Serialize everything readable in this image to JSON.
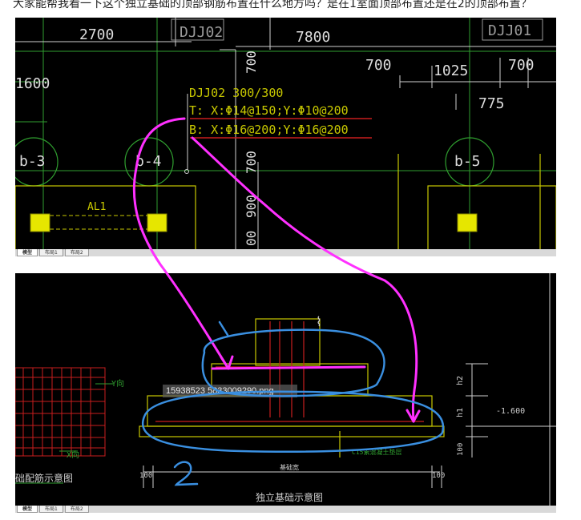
{
  "question": {
    "text": "大家能帮我看一下这个独立基础的顶部钢筋布置在什么地方吗？是在1室面顶部布置还是在2的顶部布置？"
  },
  "top_drawing": {
    "dims": {
      "d2700": "2700",
      "d7800": "7800",
      "d700a": "700",
      "d1025": "1025",
      "d700b": "700",
      "d1600": "1600",
      "d775": "775",
      "d700v": "700",
      "d900v": "900",
      "d00v": "00",
      "d700r": "700"
    },
    "labels": {
      "djj02_top": "DJJ02",
      "djj01_top": "DJJ01",
      "b3": "b-3",
      "b4": "b-4",
      "b5": "b-5",
      "al1": "AL1"
    },
    "annotation": {
      "line1": "DJJ02 300/300",
      "line2": "T: X:Φ14@150;Y:Φ10@200",
      "line3": "B: X:Φ16@200;Y:Φ16@200"
    },
    "tabs": [
      "模型",
      "布局1",
      "布局2"
    ]
  },
  "bottom_drawing": {
    "labels": {
      "y_dir": "Y向",
      "x_dir": "X向",
      "rebar_title": "础配筋示意图",
      "c15": "C15素混凝土垫层",
      "base_width": "基础宽",
      "title": "独立基础示意图"
    },
    "dims": {
      "h2": "h2",
      "h1": "h1",
      "elev": "-1.600",
      "d100a": "100",
      "d100b": "100",
      "d100c": "100"
    },
    "image_badge": "15938523 5833009290.png",
    "tabs": [
      "模型",
      "布局1",
      "布局2"
    ]
  },
  "colors": {
    "cad_bg": "#000000",
    "grid_green": "#2f9e2f",
    "text_white": "#dddddd",
    "yellow_line": "#c8c800",
    "red_line": "#c81e1e",
    "magenta_ink": "#ff30ff",
    "blue_ink": "#3a8fe0",
    "yellow_box": "#e6e600"
  }
}
